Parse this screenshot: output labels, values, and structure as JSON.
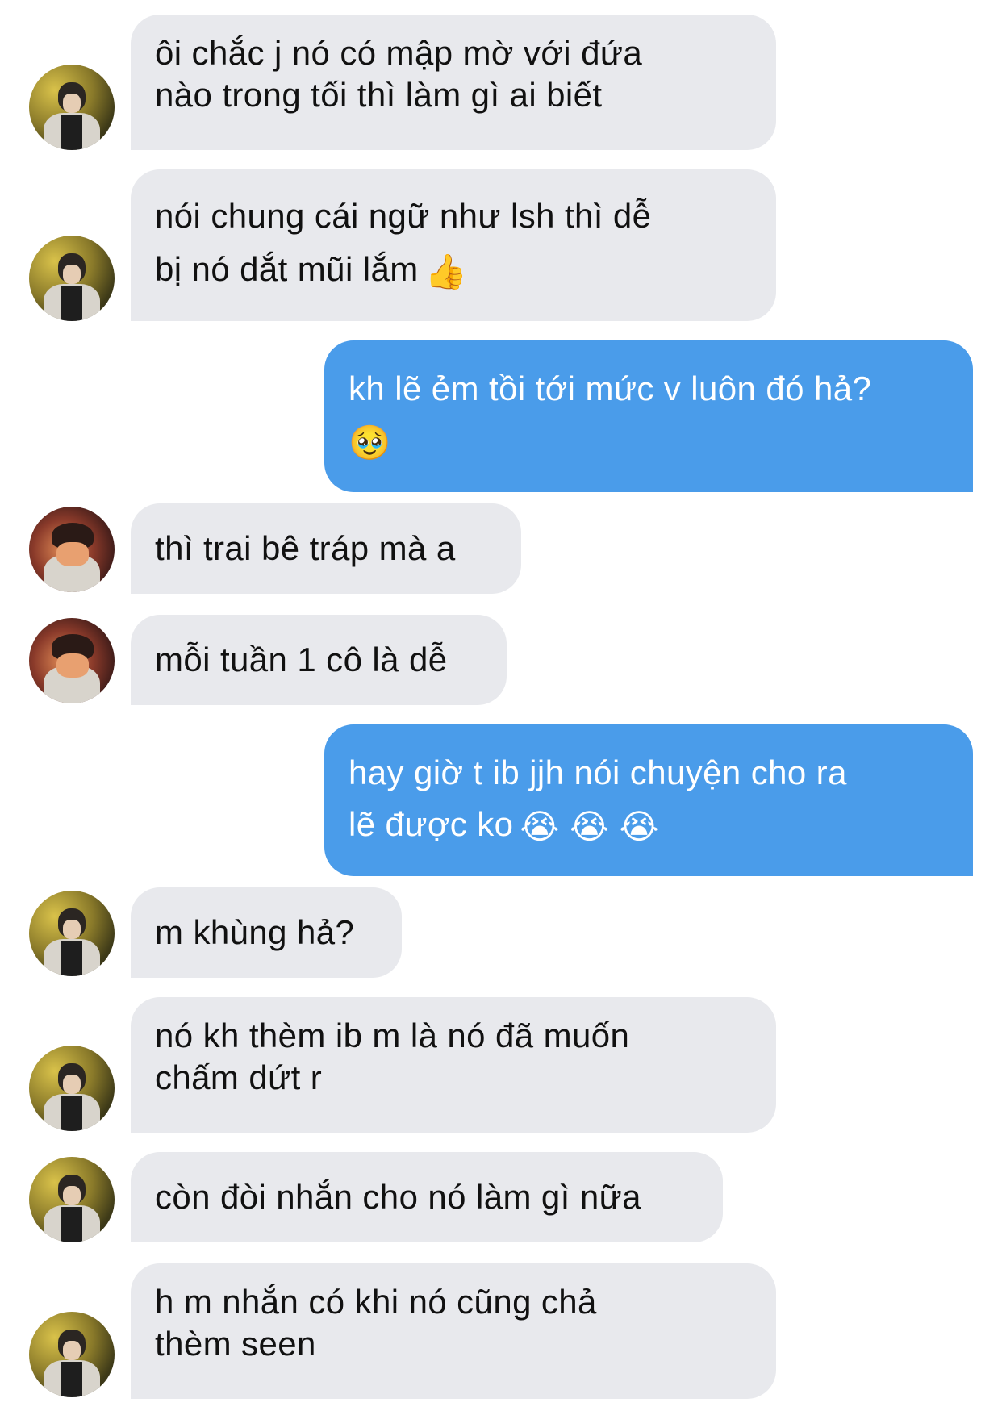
{
  "messages": [
    {
      "side": "in",
      "lines": [
        "ôi chắc j nó có mập mờ với đứa",
        "nào trong tối thì làm gì ai biết"
      ]
    },
    {
      "side": "in",
      "lines": [
        "nói chung cái ngữ như lsh thì dễ",
        "bị nó dắt mũi lắm"
      ],
      "emoji": "👍"
    },
    {
      "side": "out",
      "lines": [
        "kh lẽ ẻm tồi tới mức v luôn đó hả?",
        ""
      ],
      "emoji": "🥹"
    },
    {
      "side": "in",
      "lines": [
        "thì trai bê tráp mà a"
      ]
    },
    {
      "side": "in",
      "lines": [
        "mỗi tuần 1 cô là dễ"
      ]
    },
    {
      "side": "out",
      "lines": [
        "hay giờ t ib jjh nói chuyện cho ra",
        "lẽ được ko"
      ],
      "emoji": "😭 😭 😭"
    },
    {
      "side": "in",
      "lines": [
        "m khùng hả?"
      ]
    },
    {
      "side": "in",
      "lines": [
        "nó kh thèm ib m là nó đã muốn",
        "chấm dứt r"
      ]
    },
    {
      "side": "in",
      "lines": [
        "còn đòi nhắn cho nó làm gì nữa"
      ]
    },
    {
      "side": "in",
      "lines": [
        "h m nhắn có khi nó cũng chả",
        "thèm seen"
      ]
    }
  ],
  "colors": {
    "incoming_bubble": "#e8e9ed",
    "outgoing_bubble": "#4a9cea",
    "incoming_text": "#111111",
    "outgoing_text": "#ffffff"
  }
}
